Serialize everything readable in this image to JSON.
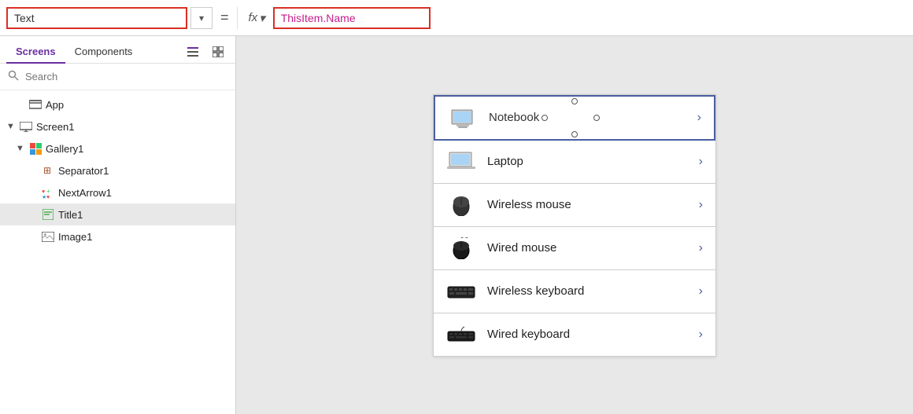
{
  "formulaBar": {
    "propertyLabel": "Text",
    "propertyPlaceholder": "Text",
    "equalsSign": "=",
    "fxLabel": "fx",
    "chevronLabel": "▾",
    "formulaValue": "ThisItem.Name"
  },
  "leftPanel": {
    "tabs": [
      {
        "id": "screens",
        "label": "Screens",
        "active": true
      },
      {
        "id": "components",
        "label": "Components",
        "active": false
      }
    ],
    "searchPlaceholder": "Search",
    "tree": [
      {
        "id": "app",
        "label": "App",
        "level": 0,
        "icon": "app",
        "hasArrow": false
      },
      {
        "id": "screen1",
        "label": "Screen1",
        "level": 0,
        "icon": "screen",
        "hasArrow": true,
        "expanded": true
      },
      {
        "id": "gallery1",
        "label": "Gallery1",
        "level": 1,
        "icon": "gallery",
        "hasArrow": true,
        "expanded": true
      },
      {
        "id": "separator1",
        "label": "Separator1",
        "level": 2,
        "icon": "separator",
        "hasArrow": false
      },
      {
        "id": "nextarrow1",
        "label": "NextArrow1",
        "level": 2,
        "icon": "nextarrow",
        "hasArrow": false
      },
      {
        "id": "title1",
        "label": "Title1",
        "level": 2,
        "icon": "title",
        "hasArrow": false,
        "selected": true
      },
      {
        "id": "image1",
        "label": "Image1",
        "level": 2,
        "icon": "image",
        "hasArrow": false
      }
    ]
  },
  "gallery": {
    "items": [
      {
        "id": "notebook",
        "label": "Notebook",
        "productType": "notebook",
        "selected": true
      },
      {
        "id": "laptop",
        "label": "Laptop",
        "productType": "laptop",
        "selected": false
      },
      {
        "id": "wireless-mouse",
        "label": "Wireless mouse",
        "productType": "wireless-mouse",
        "selected": false
      },
      {
        "id": "wired-mouse",
        "label": "Wired mouse",
        "productType": "wired-mouse",
        "selected": false
      },
      {
        "id": "wireless-keyboard",
        "label": "Wireless keyboard",
        "productType": "wireless-keyboard",
        "selected": false
      },
      {
        "id": "wired-keyboard",
        "label": "Wired keyboard",
        "productType": "wired-keyboard",
        "selected": false
      }
    ]
  },
  "colors": {
    "accent": "#6b2fa0",
    "border_selected": "#4a5fa0",
    "formula_red": "#d93025",
    "formula_pink": "#c41e8a"
  }
}
